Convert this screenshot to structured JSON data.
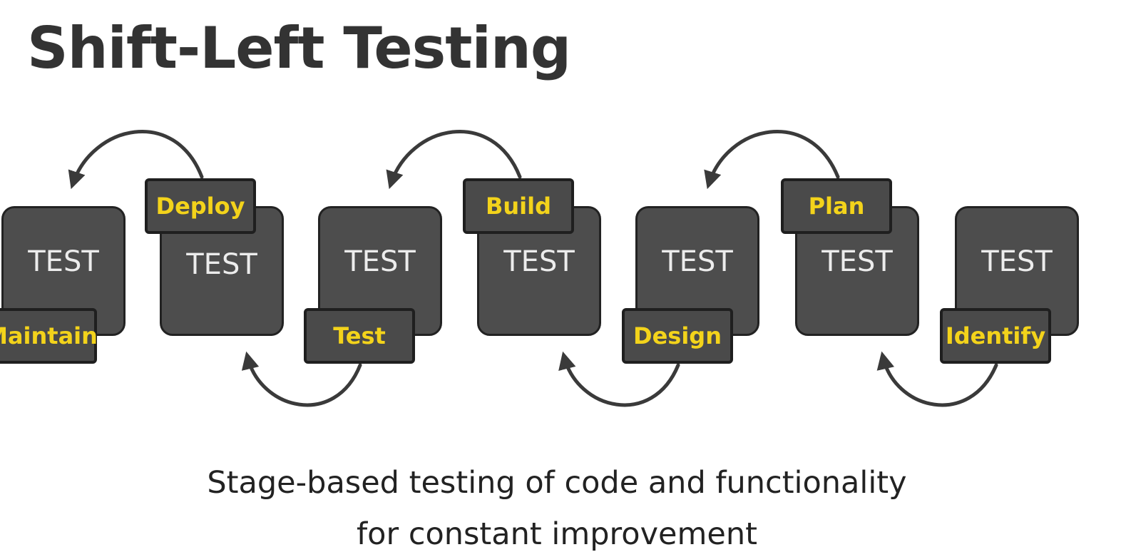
{
  "title": "Shift-Left Testing",
  "box_text": "TEST",
  "stages": {
    "maintain": "Maintain",
    "deploy": "Deploy",
    "test": "Test",
    "build": "Build",
    "design": "Design",
    "plan": "Plan",
    "identify": "Identify"
  },
  "caption": {
    "line1": "Stage-based testing of code and functionality",
    "line2": "for constant improvement"
  },
  "colors": {
    "label_text": "#f3d31b",
    "box_fill": "#4d4d4d",
    "title_text": "#333333"
  }
}
